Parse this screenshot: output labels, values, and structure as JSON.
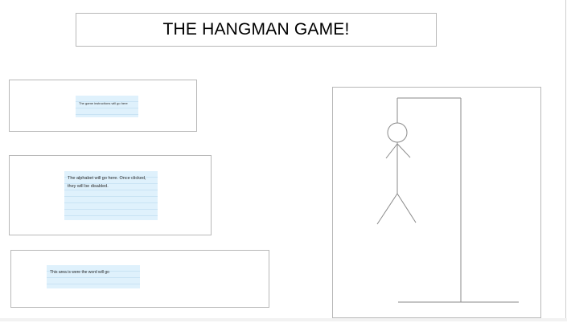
{
  "title": "THE HANGMAN GAME!",
  "instructions_note": "The game instructions will go here",
  "alphabet_note": "The alphabet will go here. Once clicked, they will be disabled.",
  "word_note": "This area is were the word will go",
  "colors": {
    "note_background": "#dff1fc",
    "box_border": "#b8b8b8",
    "drawing_stroke": "#8a8a8a"
  }
}
